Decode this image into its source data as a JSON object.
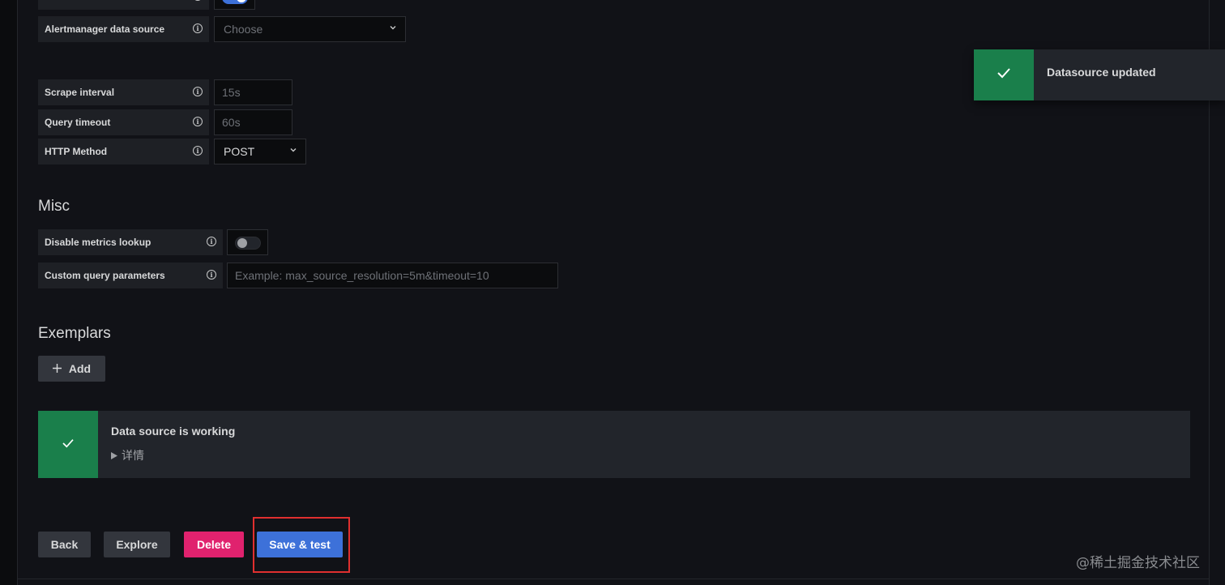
{
  "toast": {
    "message": "Datasource updated",
    "icon": "check-icon",
    "color": "#1a7f4b"
  },
  "alerting": {
    "alertmanager_label": "Alertmanager data source",
    "alertmanager_placeholder": "Choose"
  },
  "http": {
    "scrape_interval_label": "Scrape interval",
    "scrape_interval_placeholder": "15s",
    "query_timeout_label": "Query timeout",
    "query_timeout_placeholder": "60s",
    "http_method_label": "HTTP Method",
    "http_method_value": "POST"
  },
  "misc": {
    "title": "Misc",
    "disable_metrics_label": "Disable metrics lookup",
    "disable_metrics_on": false,
    "custom_params_label": "Custom query parameters",
    "custom_params_placeholder": "Example: max_source_resolution=5m&timeout=10"
  },
  "exemplars": {
    "title": "Exemplars",
    "add_label": "Add"
  },
  "status": {
    "title": "Data source is working",
    "details_label": "详情"
  },
  "actions": {
    "back": "Back",
    "explore": "Explore",
    "delete": "Delete",
    "save_test": "Save & test"
  },
  "watermark": "@稀土掘金技术社区",
  "colors": {
    "primary": "#3d71d9",
    "danger": "#e0226e",
    "success": "#1a7f4b",
    "highlight": "#e02f2f"
  }
}
